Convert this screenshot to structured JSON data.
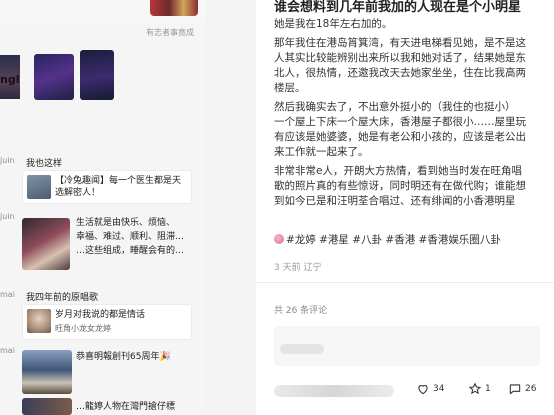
{
  "feed": {
    "ad_note": "有志者事竟成",
    "profile_name": "ngl",
    "items": [
      {
        "tag": "juin",
        "title": "我也这样",
        "card_text": "【冷兔趣闻】每一个医生都是天选解密人！",
        "thumb_color": "#6c7f8f"
      },
      {
        "tag": "juin",
        "big_text_lines": [
          "生活就是由快乐、烦恼、",
          "幸福、难过、顺利、阻滞…",
          "…这些组成，睡醒会有的…"
        ],
        "thumb_color": "#8c6a6a"
      },
      {
        "tag": "mai",
        "title": "我四年前的原唱歌",
        "card_text": "岁月对我说的都是情话",
        "card_sub": "旺角小龙女龙婷",
        "thumb_color": "#a88d7a"
      },
      {
        "tag": "mai",
        "big_text_lines": [
          "恭喜明報創刊65周年🎉"
        ],
        "thumb_color": "#5b6e8c"
      },
      {
        "tag": "",
        "big_text_lines": [
          "…龍婷人物在灣門搶仔標"
        ],
        "thumb_color": "#3a3f58"
      }
    ]
  },
  "post": {
    "title": "谁会想料到几年前我加的人现在是个小明星",
    "paragraphs": [
      [
        "她是我在18年左右加的。"
      ],
      [
        "那年我住在港岛筲箕湾，有天进电梯看见她，是不是这",
        "人其实比较能辨别出来所以我和她对话了，结果她是东",
        "北人，很热情，还邀我改天去她家坐坐，住在比我高两",
        "楼层。"
      ],
      [
        "然后我确实去了，不出意外挺小的（我住的也挺小）",
        "一个屋上下床一个屋大床，香港屋子都很小……屋里玩",
        "有应该是她婆婆，她是有老公和小孩的，应该是老公出",
        "来工作就一起来了。"
      ],
      [
        "非常非常e人，开朗大方热情，看到她当时发在旺角唱",
        "歌的照片真的有些惊讶，同时明还有在做代购；谁能想",
        "到如今已是和汪明荃合唱过、还有绯闻的小香港明星"
      ]
    ],
    "tags": "#龙婷 #港星 #八卦 #香港 #香港娱乐圈八卦",
    "meta": "3 天前 辽宁",
    "comment_count": "共 26 条评论",
    "likes": "34",
    "stars": "1",
    "comments": "26"
  }
}
